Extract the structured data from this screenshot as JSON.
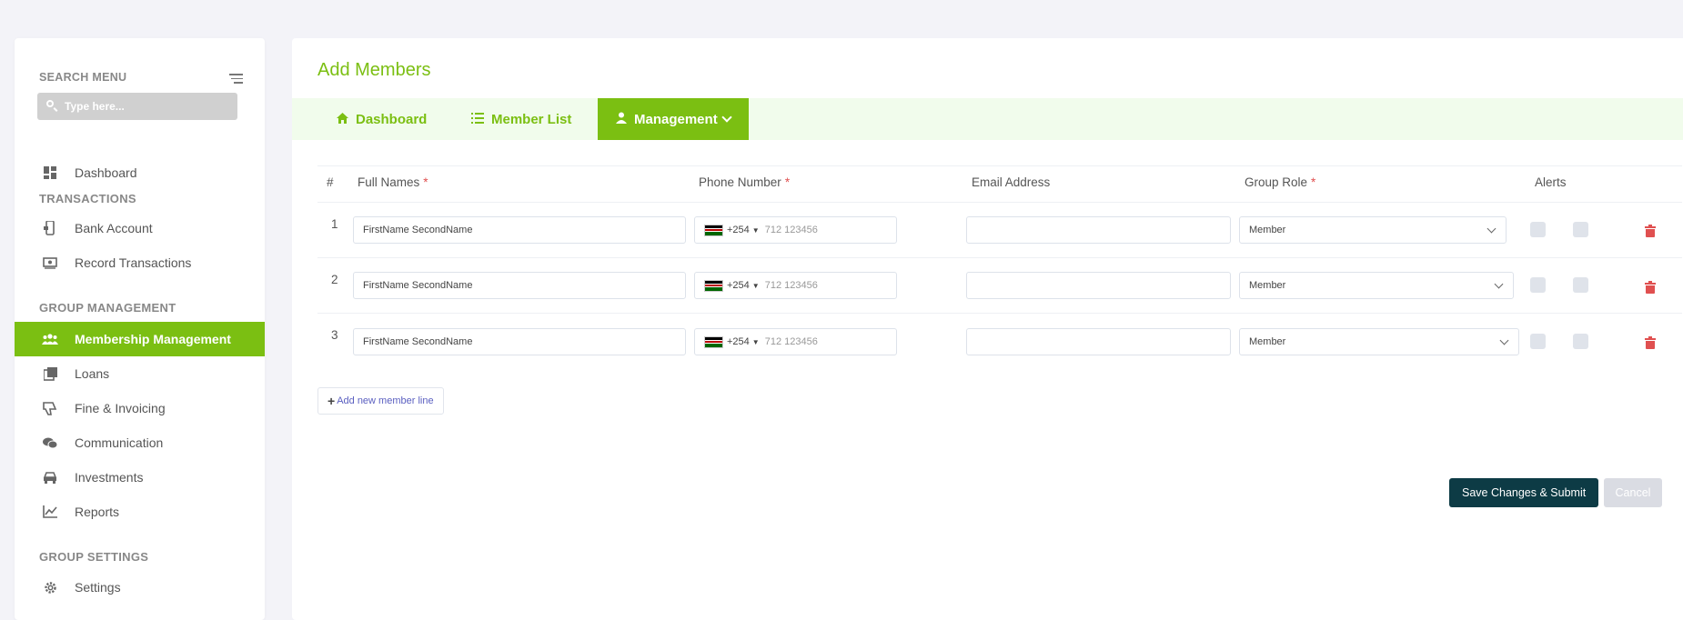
{
  "sidebar": {
    "search_heading": "SEARCH MENU",
    "search_placeholder": "Type here...",
    "sections": {
      "transactions": "TRANSACTIONS",
      "group_management": "GROUP MANAGEMENT",
      "group_settings": "GROUP SETTINGS"
    },
    "items": [
      {
        "label": "Dashboard",
        "icon": "dashboard-icon"
      },
      {
        "label": "Bank Account",
        "icon": "mobile-wallet-icon"
      },
      {
        "label": "Record Transactions",
        "icon": "money-bill-icon"
      },
      {
        "label": "Membership Management",
        "icon": "users-icon",
        "active": true
      },
      {
        "label": "Loans",
        "icon": "loans-icon"
      },
      {
        "label": "Fine & Invoicing",
        "icon": "thumbs-down-icon"
      },
      {
        "label": "Communication",
        "icon": "chat-bubbles-icon"
      },
      {
        "label": "Investments",
        "icon": "car-icon"
      },
      {
        "label": "Reports",
        "icon": "chart-line-icon"
      },
      {
        "label": "Settings",
        "icon": "gear-icon"
      }
    ]
  },
  "main": {
    "title": "Add Members",
    "tabs": [
      {
        "label": "Dashboard",
        "icon": "home-icon"
      },
      {
        "label": "Member List",
        "icon": "list-icon"
      },
      {
        "label": "Management",
        "icon": "user-icon",
        "active": true
      }
    ],
    "table": {
      "headers": {
        "number": "#",
        "full_names": "Full Names",
        "phone": "Phone Number",
        "email": "Email Address",
        "role": "Group Role",
        "alerts": "Alerts",
        "required_mark": "*"
      },
      "rows": [
        {
          "num": "1",
          "name": "FirstName SecondName",
          "country_code": "+254",
          "phone_placeholder": "712 123456",
          "email": "",
          "role": "Member"
        },
        {
          "num": "2",
          "name": "FirstName SecondName",
          "country_code": "+254",
          "phone_placeholder": "712 123456",
          "email": "",
          "role": "Member"
        },
        {
          "num": "3",
          "name": "FirstName SecondName",
          "country_code": "+254",
          "phone_placeholder": "712 123456",
          "email": "",
          "role": "Member"
        }
      ]
    },
    "add_line_label": "Add new member line",
    "save_label": "Save Changes & Submit",
    "cancel_label": "Cancel"
  },
  "colors": {
    "accent": "#7bbf12",
    "tabbar_bg": "#f1fcec",
    "save_bg": "#0d3b45",
    "danger": "#e05050"
  }
}
